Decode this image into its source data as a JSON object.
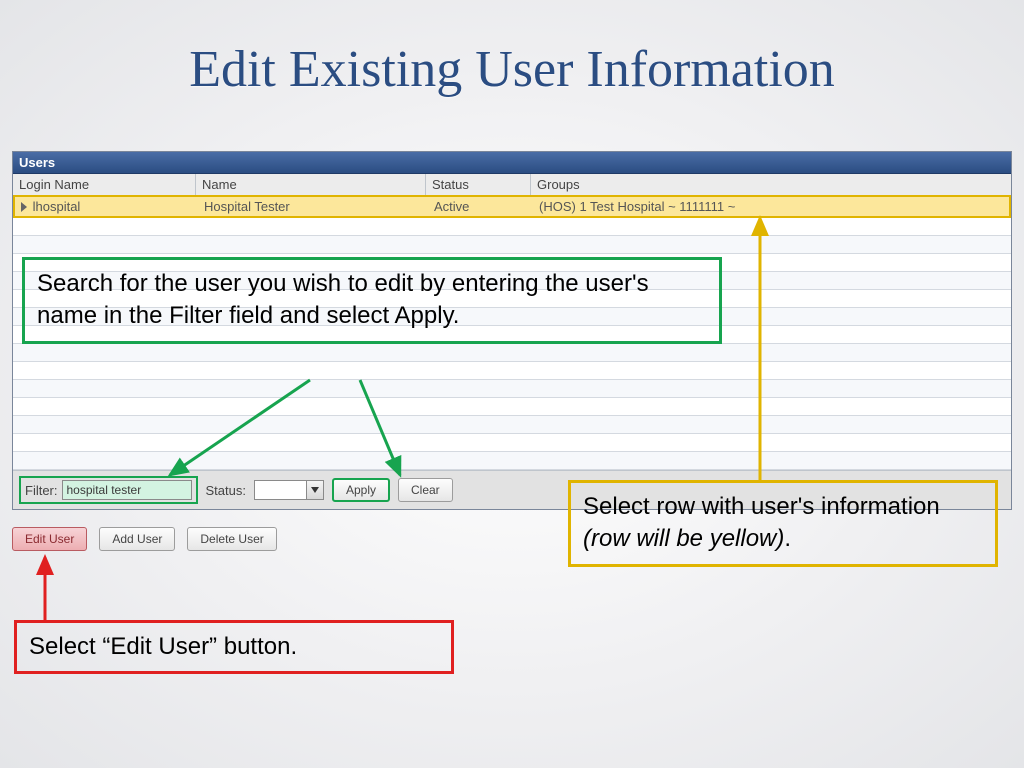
{
  "title": "Edit Existing User Information",
  "panel": {
    "header": "Users",
    "columns": {
      "login": "Login Name",
      "name": "Name",
      "status": "Status",
      "groups": "Groups"
    },
    "row": {
      "login": "lhospital",
      "name": "Hospital Tester",
      "status": "Active",
      "groups": "(HOS) 1 Test Hospital ~ 1111111 ~"
    }
  },
  "filter": {
    "label": "Filter:",
    "value": "hospital tester",
    "status_label": "Status:",
    "apply": "Apply",
    "clear": "Clear"
  },
  "actions": {
    "edit": "Edit User",
    "add": "Add User",
    "delete": "Delete User"
  },
  "annotations": {
    "search": "Search for the user you wish to edit by entering the user's name in the Filter field and select Apply.",
    "select_row_pre": "Select row with user's information ",
    "select_row_it": "(row will be yellow)",
    "select_row_post": ".",
    "edit_btn": "Select “Edit User” button."
  }
}
